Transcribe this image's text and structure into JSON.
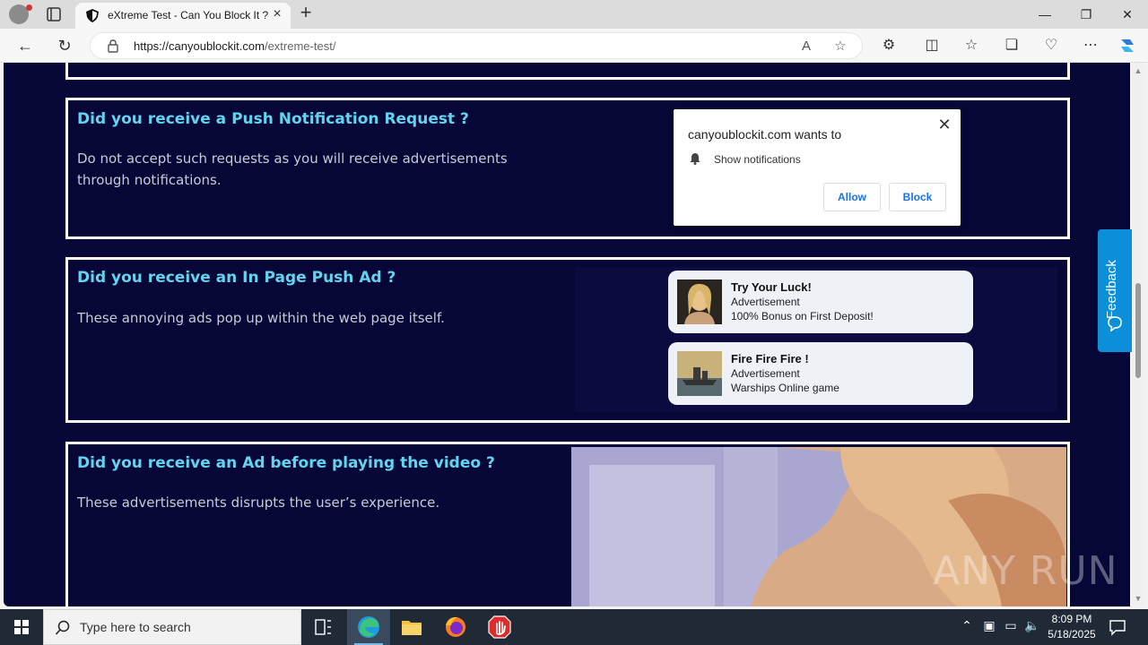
{
  "browser": {
    "tab_title": "eXtreme Test - Can You Block It ?",
    "url_host": "https://canyoublockit.com",
    "url_path": "/extreme-test/"
  },
  "sections": {
    "push": {
      "title": "Did you receive a Push Notification Request ?",
      "desc": "Do not accept such requests as you will receive advertisements through notifications.",
      "popup": {
        "site": "canyoublockit.com wants to",
        "permission": "Show notifications",
        "allow": "Allow",
        "block": "Block"
      }
    },
    "inpage": {
      "title": "Did you receive an In Page Push Ad ?",
      "desc": "These annoying ads pop up within the web page itself.",
      "ads": [
        {
          "title": "Try Your Luck!",
          "sub": "Advertisement",
          "text": "100% Bonus on First Deposit!"
        },
        {
          "title": "Fire Fire Fire !",
          "sub": "Advertisement",
          "text": "Warships Online game"
        }
      ]
    },
    "video": {
      "title": "Did you receive an Ad before playing the video ?",
      "desc": "These advertisements disrupts the user’s experience."
    }
  },
  "feedback": "Feedback",
  "watermark": "ANY RUN",
  "taskbar": {
    "search_placeholder": "Type here to search",
    "time": "8:09 PM",
    "date": "5/18/2025"
  },
  "colors": {
    "page_bg": "#070737",
    "heading": "#62d4ef",
    "feedback_bg": "#0a8fd8",
    "button_text": "#1a73e8"
  }
}
